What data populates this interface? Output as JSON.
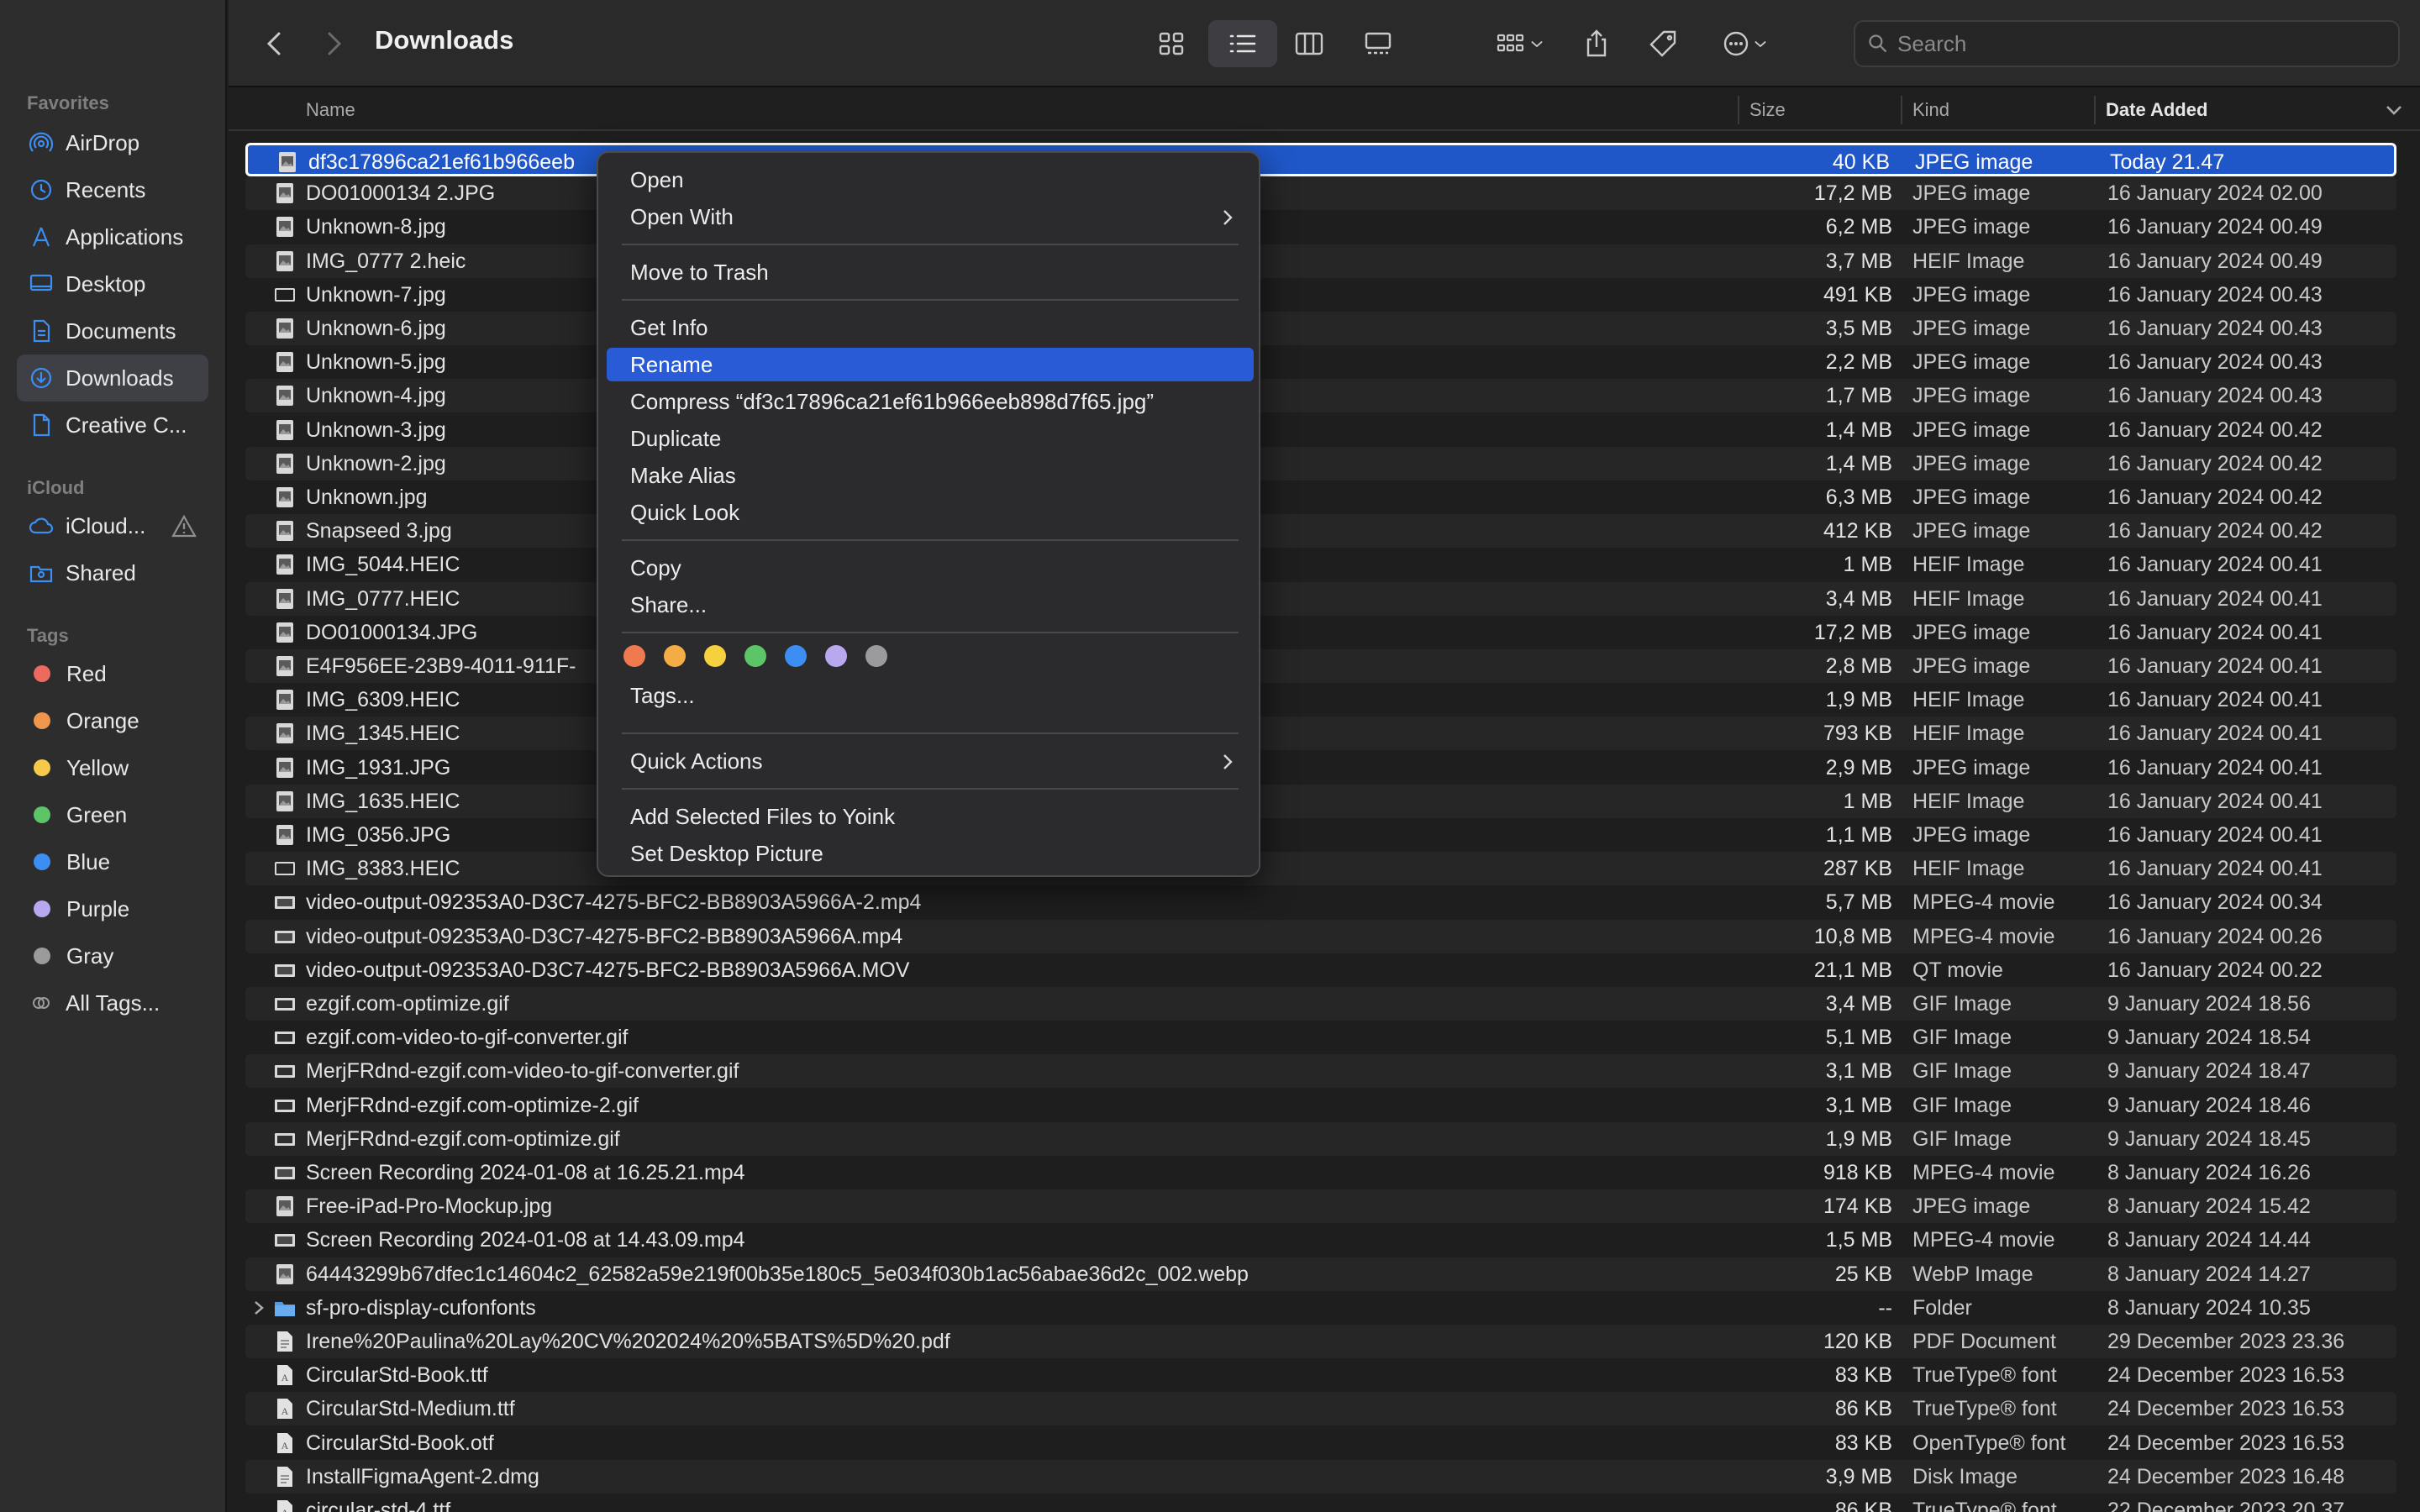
{
  "window": {
    "title": "Downloads"
  },
  "sidebar": {
    "favorites_label": "Favorites",
    "favorites": [
      {
        "label": "AirDrop",
        "icon": "airdrop-icon"
      },
      {
        "label": "Recents",
        "icon": "clock-icon"
      },
      {
        "label": "Applications",
        "icon": "applications-icon"
      },
      {
        "label": "Desktop",
        "icon": "desktop-icon"
      },
      {
        "label": "Documents",
        "icon": "document-icon"
      },
      {
        "label": "Downloads",
        "icon": "downloads-icon",
        "active": true
      },
      {
        "label": "Creative C...",
        "icon": "file-icon"
      }
    ],
    "icloud_label": "iCloud",
    "icloud": [
      {
        "label": "iCloud...",
        "icon": "cloud-icon"
      },
      {
        "label": "Shared",
        "icon": "shared-folder-icon"
      }
    ],
    "tags_label": "Tags",
    "tags": [
      {
        "label": "Red",
        "color": "#ec6a5e"
      },
      {
        "label": "Orange",
        "color": "#f0954c"
      },
      {
        "label": "Yellow",
        "color": "#f5c94a"
      },
      {
        "label": "Green",
        "color": "#5cc567"
      },
      {
        "label": "Blue",
        "color": "#3d8ef2"
      },
      {
        "label": "Purple",
        "color": "#b8a8f0"
      },
      {
        "label": "Gray",
        "color": "#9b9b9e"
      },
      {
        "label": "All Tags...",
        "color": ""
      }
    ]
  },
  "search": {
    "placeholder": "Search",
    "value": ""
  },
  "columns": {
    "name": "Name",
    "size": "Size",
    "kind": "Kind",
    "date": "Date Added"
  },
  "files": [
    {
      "name": "df3c17896ca21ef61b966eeb",
      "size": "40 KB",
      "kind": "JPEG image",
      "date": "Today 21.47",
      "selected": true,
      "icon": "image"
    },
    {
      "name": "DO01000134 2.JPG",
      "size": "17,2 MB",
      "kind": "JPEG image",
      "date": "16 January 2024 02.00",
      "icon": "image"
    },
    {
      "name": "Unknown-8.jpg",
      "size": "6,2 MB",
      "kind": "JPEG image",
      "date": "16 January 2024 00.49",
      "icon": "image"
    },
    {
      "name": "IMG_0777 2.heic",
      "size": "3,7 MB",
      "kind": "HEIF Image",
      "date": "16 January 2024 00.49",
      "icon": "image"
    },
    {
      "name": "Unknown-7.jpg",
      "size": "491 KB",
      "kind": "JPEG image",
      "date": "16 January 2024 00.43",
      "icon": "blank"
    },
    {
      "name": "Unknown-6.jpg",
      "size": "3,5 MB",
      "kind": "JPEG image",
      "date": "16 January 2024 00.43",
      "icon": "image"
    },
    {
      "name": "Unknown-5.jpg",
      "size": "2,2 MB",
      "kind": "JPEG image",
      "date": "16 January 2024 00.43",
      "icon": "image"
    },
    {
      "name": "Unknown-4.jpg",
      "size": "1,7 MB",
      "kind": "JPEG image",
      "date": "16 January 2024 00.43",
      "icon": "image"
    },
    {
      "name": "Unknown-3.jpg",
      "size": "1,4 MB",
      "kind": "JPEG image",
      "date": "16 January 2024 00.42",
      "icon": "image"
    },
    {
      "name": "Unknown-2.jpg",
      "size": "1,4 MB",
      "kind": "JPEG image",
      "date": "16 January 2024 00.42",
      "icon": "image"
    },
    {
      "name": "Unknown.jpg",
      "size": "6,3 MB",
      "kind": "JPEG image",
      "date": "16 January 2024 00.42",
      "icon": "image"
    },
    {
      "name": "Snapseed 3.jpg",
      "size": "412 KB",
      "kind": "JPEG image",
      "date": "16 January 2024 00.42",
      "icon": "image"
    },
    {
      "name": "IMG_5044.HEIC",
      "size": "1 MB",
      "kind": "HEIF Image",
      "date": "16 January 2024 00.41",
      "icon": "image"
    },
    {
      "name": "IMG_0777.HEIC",
      "size": "3,4 MB",
      "kind": "HEIF Image",
      "date": "16 January 2024 00.41",
      "icon": "image"
    },
    {
      "name": "DO01000134.JPG",
      "size": "17,2 MB",
      "kind": "JPEG image",
      "date": "16 January 2024 00.41",
      "icon": "image"
    },
    {
      "name": "E4F956EE-23B9-4011-911F-",
      "size": "2,8 MB",
      "kind": "JPEG image",
      "date": "16 January 2024 00.41",
      "icon": "image"
    },
    {
      "name": "IMG_6309.HEIC",
      "size": "1,9 MB",
      "kind": "HEIF Image",
      "date": "16 January 2024 00.41",
      "icon": "image"
    },
    {
      "name": "IMG_1345.HEIC",
      "size": "793 KB",
      "kind": "HEIF Image",
      "date": "16 January 2024 00.41",
      "icon": "image"
    },
    {
      "name": "IMG_1931.JPG",
      "size": "2,9 MB",
      "kind": "JPEG image",
      "date": "16 January 2024 00.41",
      "icon": "image"
    },
    {
      "name": "IMG_1635.HEIC",
      "size": "1 MB",
      "kind": "HEIF Image",
      "date": "16 January 2024 00.41",
      "icon": "image"
    },
    {
      "name": "IMG_0356.JPG",
      "size": "1,1 MB",
      "kind": "JPEG image",
      "date": "16 January 2024 00.41",
      "icon": "image"
    },
    {
      "name": "IMG_8383.HEIC",
      "size": "287 KB",
      "kind": "HEIF Image",
      "date": "16 January 2024 00.41",
      "icon": "blank"
    },
    {
      "name": "video-output-092353A0-D3C7-4275-BFC2-BB8903A5966A-2.mp4",
      "size": "5,7 MB",
      "kind": "MPEG-4 movie",
      "date": "16 January 2024 00.34",
      "icon": "video"
    },
    {
      "name": "video-output-092353A0-D3C7-4275-BFC2-BB8903A5966A.mp4",
      "size": "10,8 MB",
      "kind": "MPEG-4 movie",
      "date": "16 January 2024 00.26",
      "icon": "video"
    },
    {
      "name": "video-output-092353A0-D3C7-4275-BFC2-BB8903A5966A.MOV",
      "size": "21,1 MB",
      "kind": "QT movie",
      "date": "16 January 2024 00.22",
      "icon": "video"
    },
    {
      "name": "ezgif.com-optimize.gif",
      "size": "3,4 MB",
      "kind": "GIF Image",
      "date": "9 January 2024 18.56",
      "icon": "gif"
    },
    {
      "name": "ezgif.com-video-to-gif-converter.gif",
      "size": "5,1 MB",
      "kind": "GIF Image",
      "date": "9 January 2024 18.54",
      "icon": "gif"
    },
    {
      "name": "MerjFRdnd-ezgif.com-video-to-gif-converter.gif",
      "size": "3,1 MB",
      "kind": "GIF Image",
      "date": "9 January 2024 18.47",
      "icon": "gif"
    },
    {
      "name": "MerjFRdnd-ezgif.com-optimize-2.gif",
      "size": "3,1 MB",
      "kind": "GIF Image",
      "date": "9 January 2024 18.46",
      "icon": "gif"
    },
    {
      "name": "MerjFRdnd-ezgif.com-optimize.gif",
      "size": "1,9 MB",
      "kind": "GIF Image",
      "date": "9 January 2024 18.45",
      "icon": "gif"
    },
    {
      "name": "Screen Recording 2024-01-08 at 16.25.21.mp4",
      "size": "918 KB",
      "kind": "MPEG-4 movie",
      "date": "8 January 2024 16.26",
      "icon": "video"
    },
    {
      "name": "Free-iPad-Pro-Mockup.jpg",
      "size": "174 KB",
      "kind": "JPEG image",
      "date": "8 January 2024 15.42",
      "icon": "image"
    },
    {
      "name": "Screen Recording 2024-01-08 at 14.43.09.mp4",
      "size": "1,5 MB",
      "kind": "MPEG-4 movie",
      "date": "8 January 2024 14.44",
      "icon": "video"
    },
    {
      "name": "64443299b67dfec1c14604c2_62582a59e219f00b35e180c5_5e034f030b1ac56abae36d2c_002.webp",
      "size": "25 KB",
      "kind": "WebP Image",
      "date": "8 January 2024 14.27",
      "icon": "image"
    },
    {
      "name": "sf-pro-display-cufonfonts",
      "size": "--",
      "kind": "Folder",
      "date": "8 January 2024 10.35",
      "icon": "folder"
    },
    {
      "name": "Irene%20Paulina%20Lay%20CV%202024%20%5BATS%5D%20.pdf",
      "size": "120 KB",
      "kind": "PDF Document",
      "date": "29 December 2023 23.36",
      "icon": "doc"
    },
    {
      "name": "CircularStd-Book.ttf",
      "size": "83 KB",
      "kind": "TrueType® font",
      "date": "24 December 2023 16.53",
      "icon": "font"
    },
    {
      "name": "CircularStd-Medium.ttf",
      "size": "86 KB",
      "kind": "TrueType® font",
      "date": "24 December 2023 16.53",
      "icon": "font"
    },
    {
      "name": "CircularStd-Book.otf",
      "size": "83 KB",
      "kind": "OpenType® font",
      "date": "24 December 2023 16.53",
      "icon": "font"
    },
    {
      "name": "InstallFigmaAgent-2.dmg",
      "size": "3,9 MB",
      "kind": "Disk Image",
      "date": "24 December 2023 16.48",
      "icon": "doc"
    },
    {
      "name": "circular-std-4.ttf",
      "size": "86 KB",
      "kind": "TrueType® font",
      "date": "22 December 2023 20.37",
      "icon": "font"
    }
  ],
  "context_menu": {
    "open": "Open",
    "open_with": "Open With",
    "move_to_trash": "Move to Trash",
    "get_info": "Get Info",
    "rename": "Rename",
    "compress": "Compress “df3c17896ca21ef61b966eeb898d7f65.jpg”",
    "duplicate": "Duplicate",
    "make_alias": "Make Alias",
    "quick_look": "Quick Look",
    "copy": "Copy",
    "share": "Share...",
    "tag_colors": [
      "#f07a50",
      "#f3ad44",
      "#f5d03f",
      "#5cc567",
      "#3d8ef2",
      "#b8a8f0",
      "#9b9b9e"
    ],
    "tags": "Tags...",
    "quick_actions": "Quick Actions",
    "add_to_yoink": "Add Selected Files to Yoink",
    "set_desktop_picture": "Set Desktop Picture"
  }
}
